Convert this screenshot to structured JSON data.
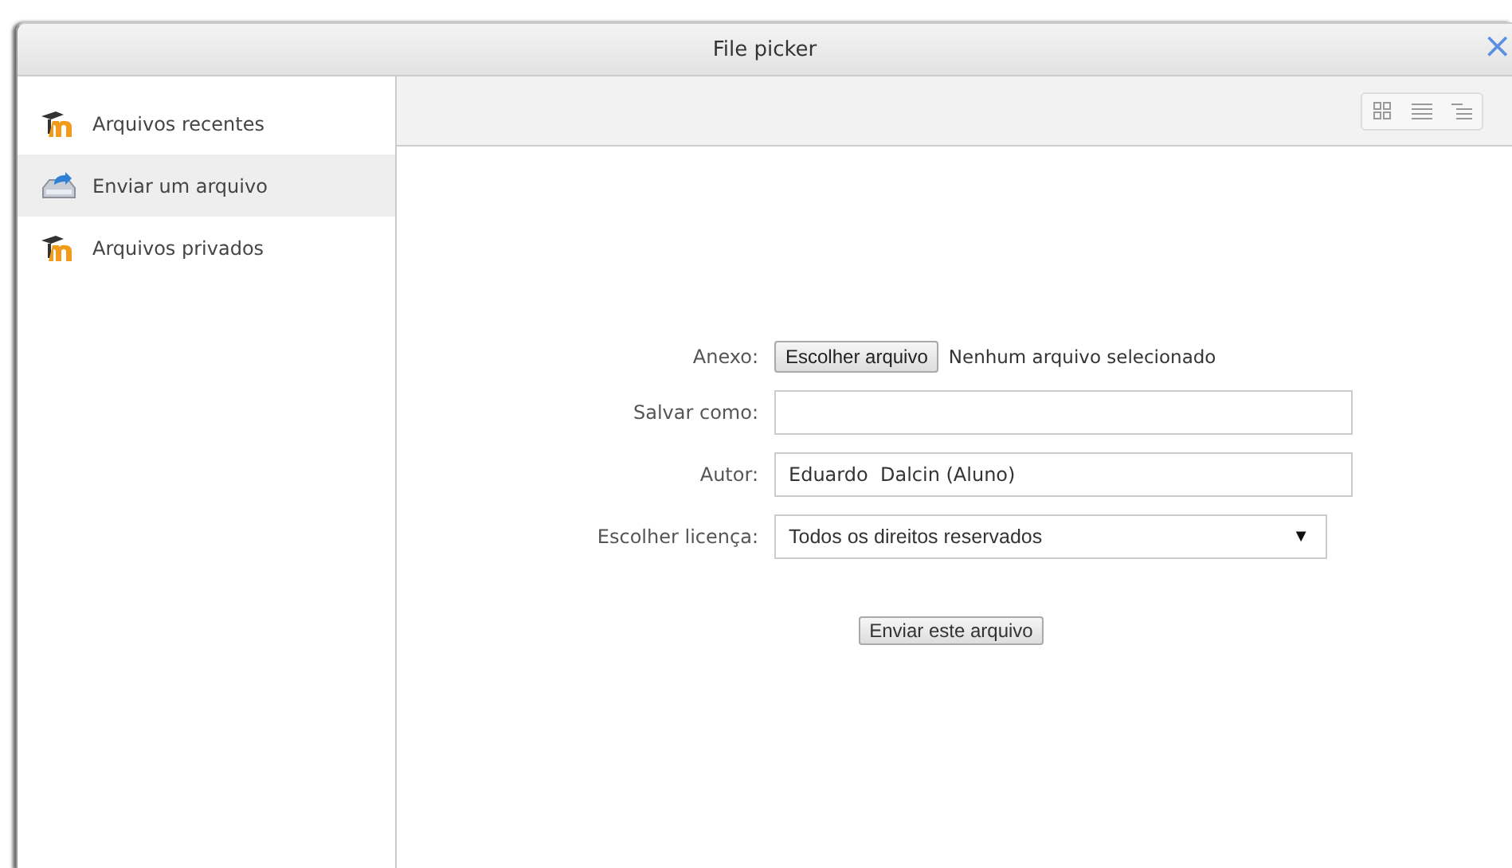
{
  "window": {
    "title": "File picker",
    "close": "×"
  },
  "sidebar": {
    "items": [
      {
        "label": "Arquivos recentes",
        "kind": "moodle",
        "selected": false
      },
      {
        "label": "Enviar um arquivo",
        "kind": "upload",
        "selected": true
      },
      {
        "label": "Arquivos privados",
        "kind": "moodle",
        "selected": false
      }
    ]
  },
  "toolbar": {
    "views": [
      {
        "kind": "icons"
      },
      {
        "kind": "list"
      },
      {
        "kind": "tree"
      }
    ]
  },
  "form": {
    "rows": [
      {
        "kind": "file",
        "label": "Anexo:",
        "button": "Escolher arquivo",
        "status": "Nenhum arquivo selecionado"
      },
      {
        "kind": "text",
        "label": "Salvar como:"
      },
      {
        "kind": "text",
        "label": "Autor:",
        "value": "Eduardo  Dalcin (Aluno)"
      },
      {
        "kind": "select",
        "label": "Escolher licença:",
        "value": "Todos os direitos reservados",
        "arrow": "▼"
      }
    ],
    "submit": "Enviar este arquivo"
  }
}
